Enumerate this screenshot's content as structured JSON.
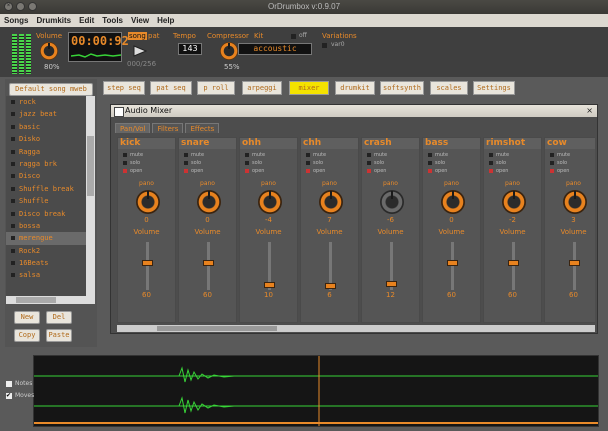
{
  "window": {
    "title": "OrDrumbox v:0.9.07"
  },
  "menu": [
    "Songs",
    "Drumkits",
    "Edit",
    "Tools",
    "View",
    "Help"
  ],
  "top": {
    "volume_label": "Volume",
    "volume_value": "80%",
    "time": "00:00:92",
    "song_label": "song",
    "pat_label": "pat",
    "tempo_label": "Tempo",
    "tempo_value": "143",
    "compressor_label": "Compressor",
    "compressor_value": "55%",
    "kit_label": "Kit",
    "kit_value": "accoustic",
    "off_label": "off",
    "variations_label": "Variations",
    "var_label": "var0",
    "counter": "000/256"
  },
  "sidebar": {
    "default_btn": "Default song mweb",
    "songs": [
      "rock",
      "jazz beat",
      "basic",
      "Disko",
      "Ragga",
      "ragga brk",
      "Disco",
      "Shuffle break",
      "Shuffle",
      "Disco break",
      "bossa",
      "merengue",
      "Rock2",
      "16Beats",
      "salsa"
    ],
    "selected": "merengue",
    "new_btn": "New",
    "del_btn": "Del",
    "copy_btn": "Copy",
    "paste_btn": "Paste"
  },
  "toolbar": [
    "step seq",
    "pat seq",
    "p roll",
    "arpeggi",
    "mixer",
    "drumkit",
    "softsynth",
    "scales",
    "Settings"
  ],
  "mixer": {
    "title": "Audio Mixer",
    "tabs": [
      "Pan/Vol",
      "Filters",
      "Effects"
    ],
    "opts": [
      "mute",
      "solo",
      "open"
    ],
    "pan_label": "pano",
    "vol_label": "Volume",
    "channels": [
      {
        "name": "kick",
        "pan": "0",
        "vol": "60",
        "level": 0.6
      },
      {
        "name": "snare",
        "pan": "0",
        "vol": "60",
        "level": 0.6
      },
      {
        "name": "ohh",
        "pan": "-4",
        "vol": "10",
        "level": 0.1
      },
      {
        "name": "chh",
        "pan": "7",
        "vol": "6",
        "level": 0.06
      },
      {
        "name": "crash",
        "pan": "-6",
        "vol": "12",
        "level": 0.12
      },
      {
        "name": "bass",
        "pan": "0",
        "vol": "60",
        "level": 0.6
      },
      {
        "name": "rimshot",
        "pan": "-2",
        "vol": "60",
        "level": 0.6
      },
      {
        "name": "cow",
        "pan": "3",
        "vol": "60",
        "level": 0.6
      }
    ]
  },
  "bottom": {
    "notes_label": "Notes",
    "moves_label": "Moves"
  },
  "colors": {
    "accent": "#e88a2a",
    "active_tab": "#f4e200",
    "wave": "#38d438"
  }
}
